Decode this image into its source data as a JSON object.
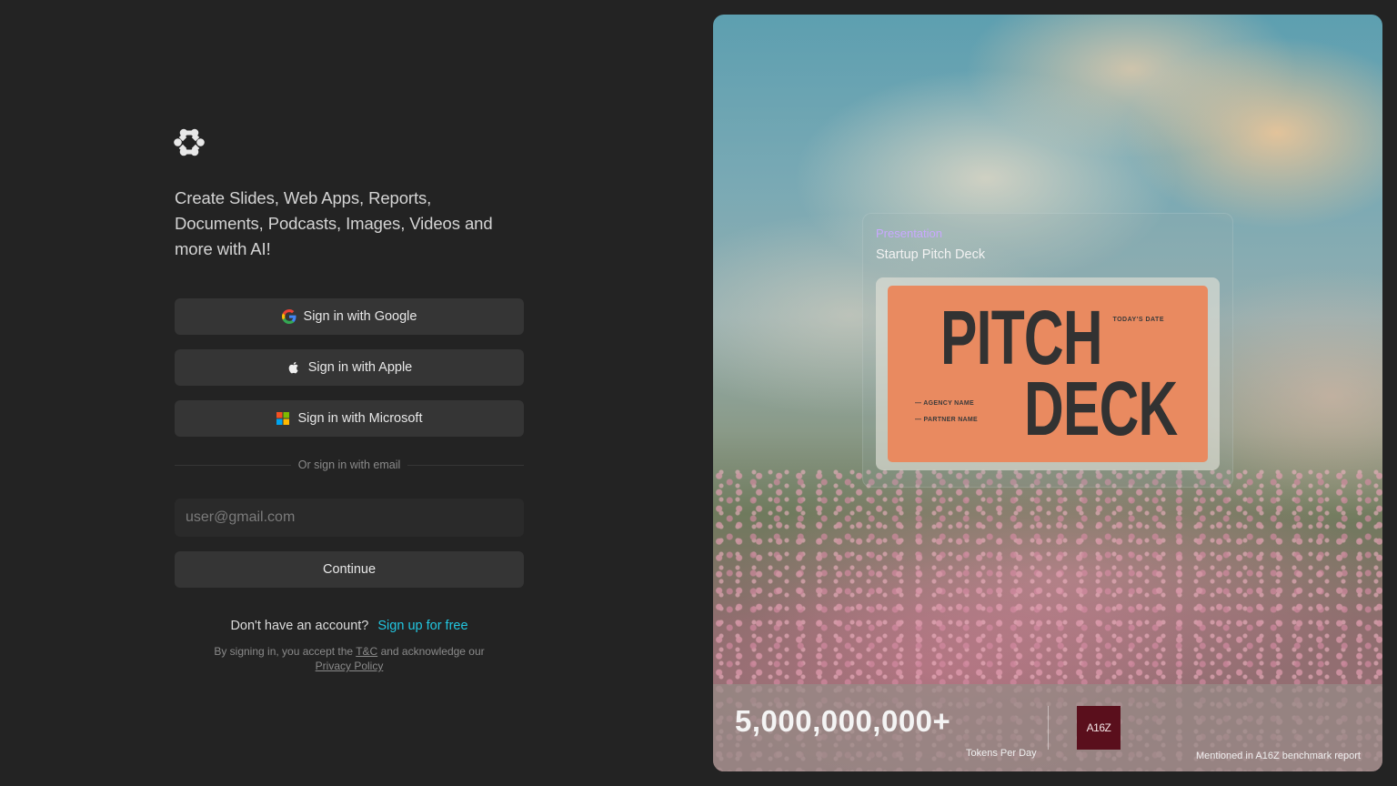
{
  "auth": {
    "tagline": "Create Slides, Web Apps, Reports, Documents, Podcasts, Images, Videos and more with AI!",
    "google_label": "Sign in with Google",
    "apple_label": "Sign in with Apple",
    "microsoft_label": "Sign in with Microsoft",
    "divider_text": "Or sign in with email",
    "email_placeholder": "user@gmail.com",
    "email_value": "",
    "continue_label": "Continue",
    "no_account_text": "Don't have an account?",
    "signup_link": "Sign up for free",
    "legal_prefix": "By signing in, you accept the",
    "tc_link": "T&C",
    "legal_middle": "and acknowledge our",
    "privacy_link": "Privacy Policy"
  },
  "hero": {
    "card_kind": "Presentation",
    "card_title": "Startup Pitch Deck",
    "slide": {
      "word1": "PITCH",
      "word2": "DECK",
      "date_label": "TODAY'S DATE",
      "agency_label": "— AGENCY NAME",
      "partner_label": "— PARTNER NAME"
    },
    "stats": {
      "tokens_value": "5,000,000,000+",
      "tokens_label": "Tokens Per Day",
      "badge_text": "A16Z",
      "mention_text": "Mentioned in A16Z benchmark report"
    }
  },
  "colors": {
    "background": "#232323",
    "button": "#353535",
    "link": "#22c6e0",
    "card_kind": "#c9a8ff",
    "slide": "#e98a60",
    "badge": "#5a0f1c"
  },
  "icons": [
    "app-logo-icon",
    "google-icon",
    "apple-icon",
    "microsoft-icon"
  ]
}
